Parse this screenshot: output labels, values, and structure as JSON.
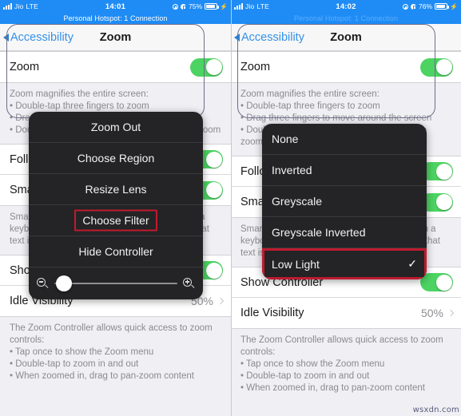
{
  "panels": [
    {
      "status": {
        "carrier": "Jio",
        "network": "LTE",
        "time": "14:01",
        "battery_percent": "75%",
        "hotspot": "Personal Hotspot: 1 Connection"
      },
      "nav": {
        "back": "Accessibility",
        "title": "Zoom"
      },
      "rows": [
        {
          "label": "Zoom",
          "type": "toggle",
          "on": true
        },
        {
          "label": "Follow Focus",
          "type": "toggle",
          "on": true
        },
        {
          "label": "Smart Typing",
          "type": "toggle",
          "on": true
        },
        {
          "label": "Show Controller",
          "type": "toggle",
          "on": true
        },
        {
          "label": "Idle Visibility",
          "type": "value",
          "value": "50%"
        }
      ],
      "desc_zoom": {
        "intro": "Zoom magnifies the entire screen:",
        "bullets": [
          "Double-tap three fingers to zoom",
          "Drag three fingers to move around the screen",
          "Double-tap three fingers and drag to change zoom"
        ]
      },
      "desc_smart": {
        "intro": "Smart Typing switches to Window Zoom when a keyboard appears and moves the window so that text is zoomed but the keyboard is not."
      },
      "desc_controller": {
        "intro": "The Zoom Controller allows quick access to zoom controls:",
        "bullets": [
          "Tap once to show the Zoom menu",
          "Double-tap to zoom in and out",
          "When zoomed in, drag to pan-zoom content"
        ]
      },
      "menu": {
        "items": [
          {
            "label": "Zoom Out",
            "highlight": false,
            "checked": false
          },
          {
            "label": "Choose Region",
            "highlight": false,
            "checked": false
          },
          {
            "label": "Resize Lens",
            "highlight": false,
            "checked": false
          },
          {
            "label": "Choose Filter",
            "highlight": true,
            "checked": false
          },
          {
            "label": "Hide Controller",
            "highlight": false,
            "checked": false
          }
        ],
        "has_slider": true,
        "slider_zoom_out_icon": "magnifier-minus-icon",
        "slider_zoom_in_icon": "magnifier-plus-icon"
      }
    },
    {
      "status": {
        "carrier": "Jio",
        "network": "LTE",
        "time": "14:02",
        "battery_percent": "76%",
        "hotspot": "Personal Hotspot: 1 Connection"
      },
      "nav": {
        "back": "Accessibility",
        "title": "Zoom"
      },
      "rows": [
        {
          "label": "Zoom",
          "type": "toggle",
          "on": true
        },
        {
          "label": "Follow Focus",
          "type": "toggle",
          "on": true
        },
        {
          "label": "Smart Typing",
          "type": "toggle",
          "on": true
        },
        {
          "label": "Show Controller",
          "type": "toggle",
          "on": true
        },
        {
          "label": "Idle Visibility",
          "type": "value",
          "value": "50%"
        }
      ],
      "desc_zoom": {
        "intro": "Zoom magnifies the entire screen:",
        "bullets": [
          "Double-tap three fingers to zoom",
          "Drag three fingers to move around the screen",
          "Double-tap three fingers and drag to change zoom"
        ]
      },
      "desc_smart": {
        "intro": "Smart Typing switches to Window Zoom when a keyboard appears and moves the window so that text is zoomed but the keyboard is not."
      },
      "desc_controller": {
        "intro": "The Zoom Controller allows quick access to zoom controls:",
        "bullets": [
          "Tap once to show the Zoom menu",
          "Double-tap to zoom in and out",
          "When zoomed in, drag to pan-zoom content"
        ]
      },
      "menu": {
        "items": [
          {
            "label": "None",
            "highlight": false,
            "checked": false
          },
          {
            "label": "Inverted",
            "highlight": false,
            "checked": false
          },
          {
            "label": "Greyscale",
            "highlight": false,
            "checked": false
          },
          {
            "label": "Greyscale Inverted",
            "highlight": false,
            "checked": false
          },
          {
            "label": "Low Light",
            "highlight": true,
            "checked": true
          }
        ],
        "has_slider": false
      }
    }
  ],
  "watermark": "wsxdn.com",
  "colors": {
    "status_blue": "#1f8cf6",
    "toggle_green": "#4cd362",
    "highlight_red": "#bf1a2f",
    "menu_dark": "#242426",
    "link_blue": "#3591e8"
  }
}
